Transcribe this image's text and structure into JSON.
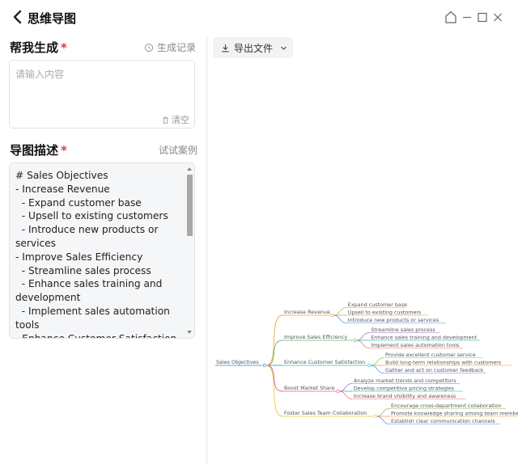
{
  "titlebar": {
    "title": "思维导图",
    "icons": [
      "back-arrow-icon",
      "home-icon",
      "minimize-icon",
      "maximize-icon",
      "close-icon"
    ]
  },
  "prompt_section": {
    "title": "帮我生成",
    "required_mark": "*",
    "history_label": "生成记录",
    "placeholder": "请输入内容",
    "value": "",
    "clear_label": "清空"
  },
  "desc_section": {
    "title": "导图描述",
    "required_mark": "*",
    "example_label": "试试案例",
    "text": "# Sales Objectives\n- Increase Revenue\n  - Expand customer base\n  - Upsell to existing customers\n  - Introduce new products or services\n- Improve Sales Efficiency\n  - Streamline sales process\n  - Enhance sales training and development\n  - Implement sales automation tools\n- Enhance Customer Satisfaction\n  - Provide excellent customer service"
  },
  "toolbar": {
    "export_label": "导出文件"
  },
  "mindmap": {
    "root": "Sales Objectives",
    "branches": [
      {
        "label": "Increase Revenue",
        "color": "#f0a23b",
        "children": [
          "Expand customer base",
          "Upsell to existing customers",
          "Introduce new products or services"
        ]
      },
      {
        "label": "Improve Sales Efficiency",
        "color": "#6bb86a",
        "children": [
          "Streamline sales process",
          "Enhance sales training and development",
          "Implement sales automation tools"
        ]
      },
      {
        "label": "Enhance Customer Satisfaction",
        "color": "#3fb6c9",
        "children": [
          "Provide excellent customer service",
          "Build long-term relationships with customers",
          "Gather and act on customer feedback"
        ]
      },
      {
        "label": "Boost Market Share",
        "color": "#e0559a",
        "children": [
          "Analyze market trends and competitors",
          "Develop competitive pricing strategies",
          "Increase brand visibility and awareness"
        ]
      },
      {
        "label": "Foster Sales Team Collaboration",
        "color": "#e6c93a",
        "children": [
          "Encourage cross-department collaboration",
          "Promote knowledge sharing among team members",
          "Establish clear communication channels"
        ]
      }
    ],
    "leaf_colors": [
      "#8bc34a",
      "#f28b30",
      "#4f8fe0",
      "#9c6ad1",
      "#26a69a",
      "#ef6c6c"
    ]
  }
}
